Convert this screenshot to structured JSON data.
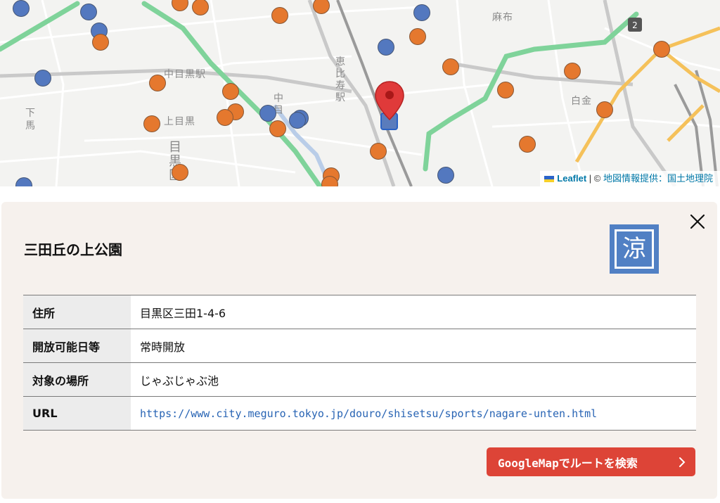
{
  "map": {
    "labels": {
      "nakameguro_station": "中目黒駅",
      "kamimeguro": "上目黒",
      "shimomeguro": "下\n馬",
      "ebisu_station": "恵\n比\n寿\n駅",
      "naka": "中\n目",
      "azabu": "麻布",
      "shirokane": "白金",
      "meguroku": "目\n黒\n区",
      "route_shield": "2"
    },
    "colors": {
      "orange_marker": "#e5782e",
      "blue_marker": "#5378bf",
      "pin": "#e03a3a",
      "park_line": "#7fd39a"
    },
    "attribution": {
      "leaflet": "Leaflet",
      "separator": " | © ",
      "provider": "地図情報提供：国土地理院"
    }
  },
  "panel": {
    "close_icon": "close-icon",
    "title": "三田丘の上公園",
    "badge_char": "涼",
    "rows": [
      {
        "label": "住所",
        "value": "目黒区三田1-4-6"
      },
      {
        "label": "開放可能日等",
        "value": "常時開放"
      },
      {
        "label": "対象の場所",
        "value": "じゃぶじゃぶ池"
      },
      {
        "label": "URL",
        "value": "https://www.city.meguro.tokyo.jp/douro/shisetsu/sports/nagare-unten.html"
      }
    ],
    "route_button": "GoogleMapでルートを検索"
  }
}
